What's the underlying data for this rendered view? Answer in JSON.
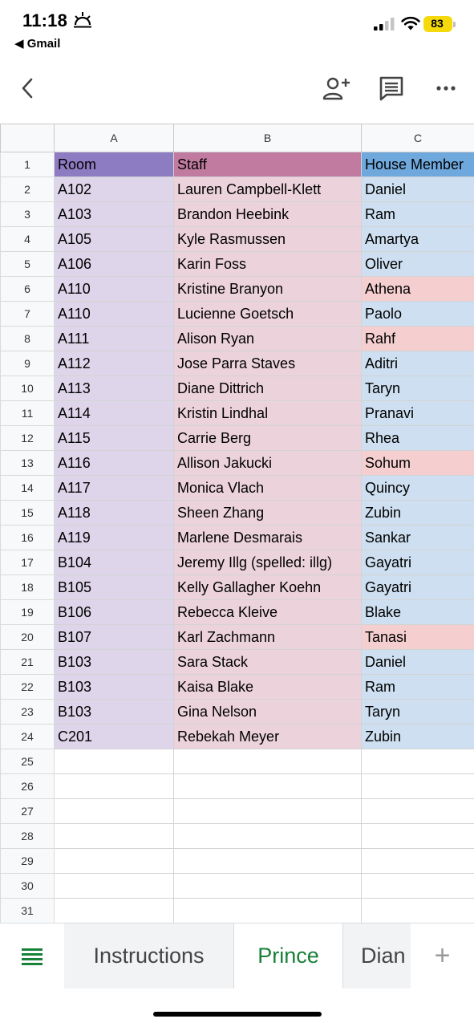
{
  "status_bar": {
    "time": "11:18",
    "back_app": "◀ Gmail",
    "battery": "83"
  },
  "toolbar": {
    "icons": [
      "back-icon",
      "add-person-icon",
      "comment-icon",
      "more-icon"
    ]
  },
  "sheet": {
    "column_headers": [
      "A",
      "B",
      "C"
    ],
    "header_row": {
      "row": "1",
      "room": "Room",
      "staff": "Staff",
      "house_member": "House Member"
    },
    "rows": [
      {
        "n": "2",
        "room": "A102",
        "staff": "Lauren Campbell-Klett",
        "member": "Daniel",
        "highlight": false
      },
      {
        "n": "3",
        "room": "A103",
        "staff": "Brandon Heebink",
        "member": "Ram",
        "highlight": false
      },
      {
        "n": "4",
        "room": "A105",
        "staff": "Kyle Rasmussen",
        "member": "Amartya",
        "highlight": false
      },
      {
        "n": "5",
        "room": "A106",
        "staff": "Karin Foss",
        "member": "Oliver",
        "highlight": false
      },
      {
        "n": "6",
        "room": "A110",
        "staff": "Kristine Branyon",
        "member": "Athena",
        "highlight": true
      },
      {
        "n": "7",
        "room": "A110",
        "staff": "Lucienne Goetsch",
        "member": "Paolo",
        "highlight": false
      },
      {
        "n": "8",
        "room": "A111",
        "staff": "Alison Ryan",
        "member": "Rahf",
        "highlight": true
      },
      {
        "n": "9",
        "room": "A112",
        "staff": "Jose Parra Staves",
        "member": "Aditri",
        "highlight": false
      },
      {
        "n": "10",
        "room": "A113",
        "staff": "Diane Dittrich",
        "member": "Taryn",
        "highlight": false
      },
      {
        "n": "11",
        "room": "A114",
        "staff": "Kristin Lindhal",
        "member": "Pranavi",
        "highlight": false
      },
      {
        "n": "12",
        "room": "A115",
        "staff": "Carrie Berg",
        "member": "Rhea",
        "highlight": false
      },
      {
        "n": "13",
        "room": "A116",
        "staff": "Allison Jakucki",
        "member": "Sohum",
        "highlight": true
      },
      {
        "n": "14",
        "room": "A117",
        "staff": "Monica Vlach",
        "member": "Quincy",
        "highlight": false
      },
      {
        "n": "15",
        "room": "A118",
        "staff": "Sheen Zhang",
        "member": "Zubin",
        "highlight": false
      },
      {
        "n": "16",
        "room": "A119",
        "staff": "Marlene Desmarais",
        "member": "Sankar",
        "highlight": false
      },
      {
        "n": "17",
        "room": "B104",
        "staff": "Jeremy Illg (spelled: illg)",
        "member": "Gayatri",
        "highlight": false
      },
      {
        "n": "18",
        "room": "B105",
        "staff": "Kelly Gallagher Koehn",
        "member": "Gayatri",
        "highlight": false
      },
      {
        "n": "19",
        "room": "B106",
        "staff": "Rebecca Kleive",
        "member": "Blake",
        "highlight": false
      },
      {
        "n": "20",
        "room": "B107",
        "staff": "Karl Zachmann",
        "member": "Tanasi",
        "highlight": true
      },
      {
        "n": "21",
        "room": "B103",
        "staff": "Sara Stack",
        "member": "Daniel",
        "highlight": false
      },
      {
        "n": "22",
        "room": "B103",
        "staff": "Kaisa Blake",
        "member": "Ram",
        "highlight": false
      },
      {
        "n": "23",
        "room": "B103",
        "staff": "Gina Nelson",
        "member": "Taryn",
        "highlight": false
      },
      {
        "n": "24",
        "room": "C201",
        "staff": "Rebekah Meyer",
        "member": "Zubin",
        "highlight": false
      }
    ],
    "empty_rows": [
      "25",
      "26",
      "27",
      "28",
      "29",
      "30",
      "31"
    ]
  },
  "tabs": {
    "items": [
      {
        "label": "Instructions",
        "active": false
      },
      {
        "label": "Prince",
        "active": true
      },
      {
        "label": "Dian",
        "active": false
      }
    ],
    "add_label": "+"
  },
  "colors": {
    "room_header": "#8e7cc3",
    "staff_header": "#c27ba0",
    "member_header": "#6fa8dc",
    "room_cell": "#ded5ea",
    "staff_cell": "#ecd3db",
    "member_cell": "#cddff0",
    "member_highlight": "#f5cfd0",
    "active_tab": "#188038"
  }
}
